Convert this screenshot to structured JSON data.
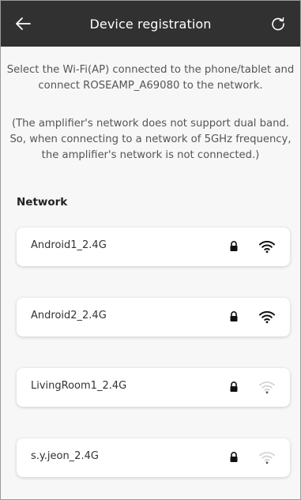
{
  "header": {
    "title": "Device registration",
    "back_icon": "arrow-left-icon",
    "refresh_icon": "refresh-icon",
    "background": "#313131"
  },
  "instructions": {
    "line1": "Select the Wi-Fi(AP) connected to the phone/tablet and",
    "line2": "connect ROSEAMP_A69080 to the network."
  },
  "note": {
    "line1": "(The amplifier's network does not support dual band.",
    "line2": "So, when connecting to a network of 5GHz frequency,",
    "line3": "the amplifier's network is not connected.)"
  },
  "section": {
    "title": "Network"
  },
  "networks": [
    {
      "ssid": "Android1_2.4G",
      "locked": true,
      "signal": "strong"
    },
    {
      "ssid": "Android2_2.4G",
      "locked": true,
      "signal": "strong"
    },
    {
      "ssid": "LivingRoom1_2.4G",
      "locked": true,
      "signal": "weak"
    },
    {
      "ssid": "s.y.jeon_2.4G",
      "locked": true,
      "signal": "weak"
    }
  ],
  "colors": {
    "signal_strong": "#111111",
    "signal_weak": "#c8c8c8"
  }
}
